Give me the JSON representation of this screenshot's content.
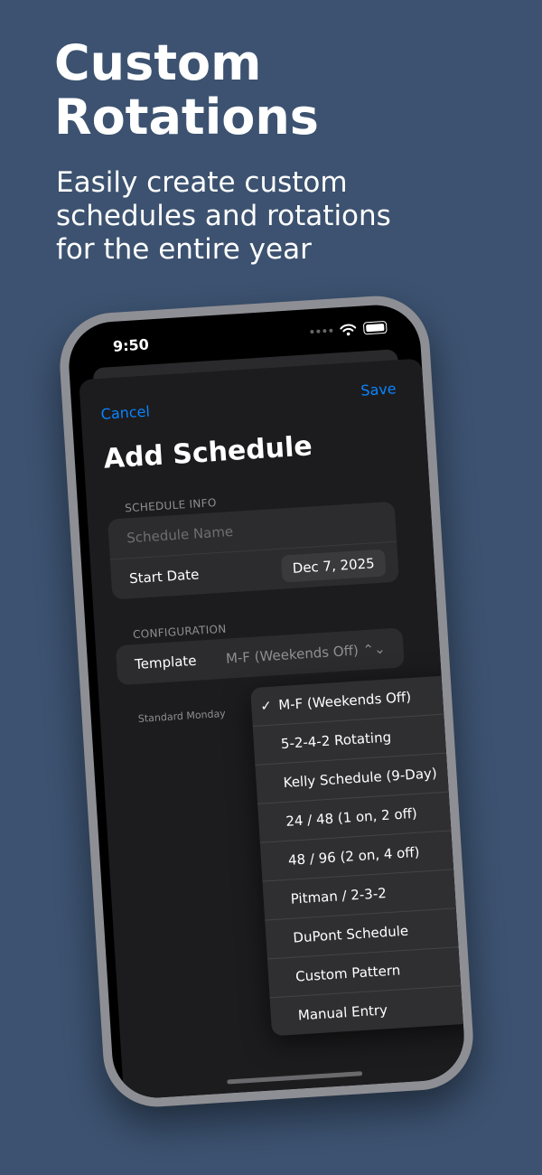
{
  "hero": {
    "title": "Custom Rotations",
    "subtitle": "Easily create custom schedules and rotations for the entire year"
  },
  "status_bar": {
    "time": "9:50"
  },
  "nav": {
    "cancel_label": "Cancel",
    "save_label": "Save"
  },
  "sheet": {
    "title": "Add Schedule"
  },
  "schedule_info": {
    "header": "SCHEDULE INFO",
    "name_placeholder": "Schedule Name",
    "start_date_label": "Start Date",
    "start_date_value": "Dec 7, 2025"
  },
  "configuration": {
    "header": "CONFIGURATION",
    "template_label": "Template",
    "template_value": "M-F (Weekends Off) ⌃⌄",
    "footnote": "Standard Monday"
  },
  "menu": {
    "check_glyph": "✓",
    "items": [
      "M-F (Weekends Off)",
      "5-2-4-2 Rotating",
      "Kelly Schedule (9-Day)",
      "24 / 48 (1 on, 2 off)",
      "48 / 96 (2 on, 4 off)",
      "Pitman / 2-3-2",
      "DuPont Schedule",
      "Custom Pattern",
      "Manual Entry"
    ]
  },
  "colors": {
    "background": "#3c5270",
    "accent": "#0a84ff",
    "sheet": "#1c1c1e",
    "group": "#2c2c2e"
  }
}
